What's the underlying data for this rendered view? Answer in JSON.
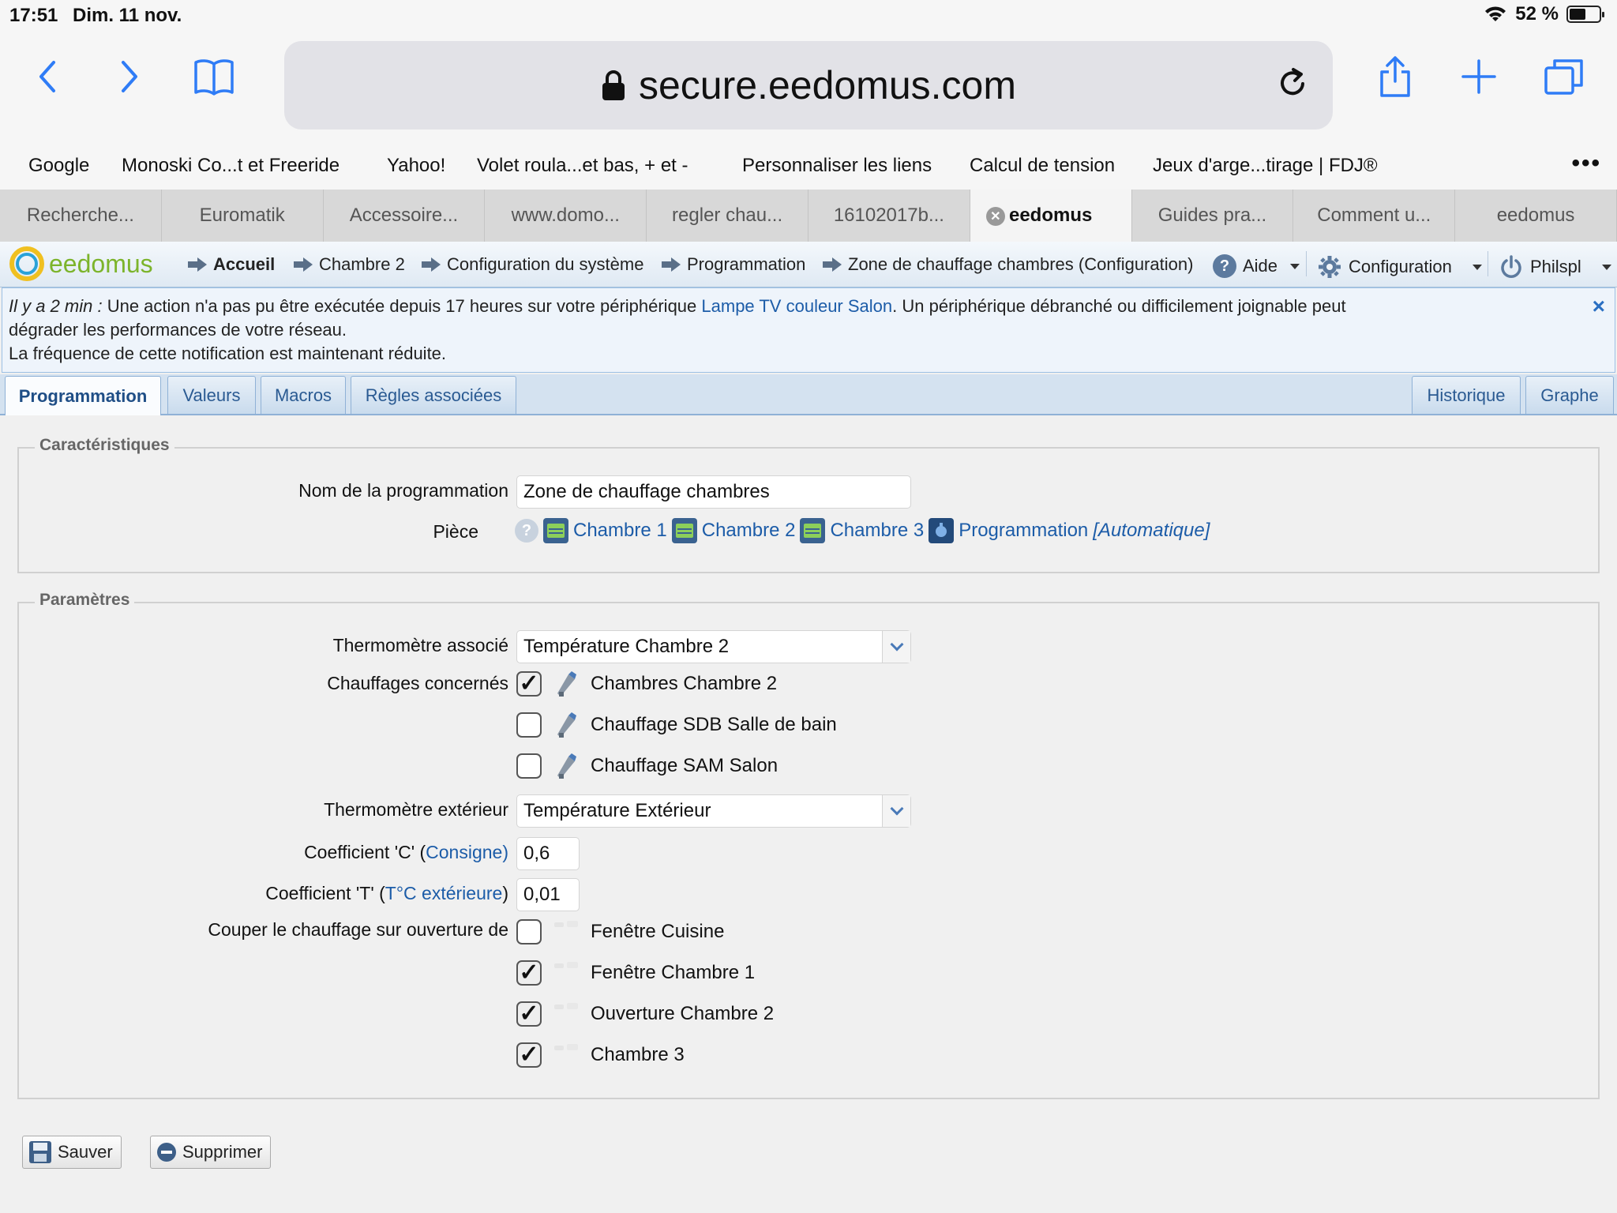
{
  "status_bar": {
    "time": "17:51",
    "date": "Dim. 11 nov.",
    "battery_percent": "52 %",
    "battery_level": 0.52
  },
  "browser": {
    "url": "secure.eedomus.com",
    "bookmarks": [
      "Google",
      "Monoski Co...t et Freeride",
      "Yahoo!",
      "Volet roula...et bas, + et -",
      "Personnaliser les liens",
      "Calcul de tension",
      "Jeux d'arge...tirage | FDJ®"
    ],
    "more": "•••",
    "tabs": [
      {
        "label": "Recherche..."
      },
      {
        "label": "Euromatik"
      },
      {
        "label": "Accessoire..."
      },
      {
        "label": "www.domo..."
      },
      {
        "label": "regler chau..."
      },
      {
        "label": "16102017b..."
      },
      {
        "label": "eedomus",
        "active": true
      },
      {
        "label": "Guides pra..."
      },
      {
        "label": "Comment u..."
      },
      {
        "label": "eedomus"
      }
    ]
  },
  "app": {
    "logo": "eedomus",
    "breadcrumbs": [
      "Accueil",
      "Chambre 2",
      "Configuration du système",
      "Programmation",
      "Zone de chauffage chambres (Configuration)"
    ],
    "help": "Aide",
    "config": "Configuration",
    "user": "Philspl",
    "colors": {
      "link": "#1c5ca8",
      "accent": "#7cb42b",
      "logo_ring_outer": "#f0c020",
      "logo_ring_inner": "#2aa2d8"
    }
  },
  "notification": {
    "time": "Il y a 2 min :",
    "text1": " Une action n'a pas pu être exécutée depuis 17 heures sur votre périphérique ",
    "device_link": "Lampe TV couleur Salon",
    "text2": ". Un périphérique débranché ou difficilement joignable peut",
    "line2": "dégrader les performances de votre réseau.",
    "line3": "La fréquence de cette notification est maintenant réduite.",
    "close": "×"
  },
  "subtabs": {
    "left": [
      "Programmation",
      "Valeurs",
      "Macros",
      "Règles associées"
    ],
    "right": [
      "Historique",
      "Graphe"
    ]
  },
  "caracteristiques": {
    "legend": "Caractéristiques",
    "name_label": "Nom de la programmation",
    "name_value": "Zone de chauffage chambres",
    "piece_label": "Pièce",
    "help_glyph": "?",
    "rooms": [
      "Chambre 1",
      "Chambre 2",
      "Chambre 3"
    ],
    "program_link": "Programmation",
    "program_mode": "[Automatique]"
  },
  "parametres": {
    "legend": "Paramètres",
    "thermo_label": "Thermomètre associé",
    "thermo_value": "Température Chambre 2",
    "heaters_label": "Chauffages concernés",
    "heaters": [
      {
        "label": "Chambres Chambre 2",
        "checked": true
      },
      {
        "label": "Chauffage SDB Salle de bain",
        "checked": false
      },
      {
        "label": "Chauffage SAM Salon",
        "checked": false
      }
    ],
    "ext_label": "Thermomètre extérieur",
    "ext_value": "Température Extérieur",
    "coef_c_label": "Coefficient 'C' (",
    "coef_c_link": "Consigne)",
    "coef_c_value": "0,6",
    "coef_t_label": "Coefficient 'T' (",
    "coef_t_link": "T°C extérieure",
    "coef_t_close": ")",
    "coef_t_value": "0,01",
    "cut_label": "Couper le chauffage sur ouverture de",
    "openings": [
      {
        "label": "Fenêtre Cuisine",
        "checked": false
      },
      {
        "label": "Fenêtre Chambre 1",
        "checked": true
      },
      {
        "label": "Ouverture Chambre 2",
        "checked": true
      },
      {
        "label": "Chambre 3",
        "checked": true
      }
    ]
  },
  "actions": {
    "save": "Sauver",
    "delete": "Supprimer"
  }
}
